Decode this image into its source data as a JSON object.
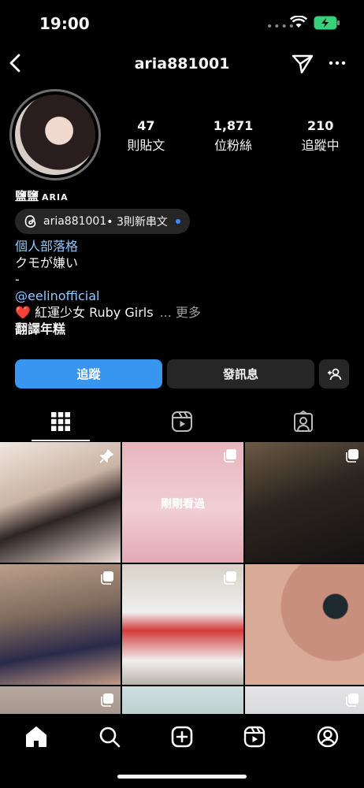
{
  "status": {
    "time": "19:00"
  },
  "header": {
    "username": "aria881001"
  },
  "profile": {
    "stats": [
      {
        "value": "47",
        "label": "則貼文"
      },
      {
        "value": "1,871",
        "label": "位粉絲"
      },
      {
        "value": "210",
        "label": "追蹤中"
      }
    ],
    "display_name": "鹽鹽",
    "display_name_latin": "ARIA",
    "threads": {
      "handle": "aria881001",
      "suffix": " • 3則新串文"
    },
    "bio": {
      "category": "個人部落格",
      "line1": "クモが嫌い",
      "line2": "-",
      "mention": "@eelinofficial",
      "line3": "❤️ 紅運少女 Ruby Girls",
      "more": "... 更多",
      "translate": "翻譯年糕"
    }
  },
  "buttons": {
    "follow": "追蹤",
    "message": "發訊息"
  },
  "grid": {
    "recent_label": "剛剛看過"
  },
  "colors": {
    "accent": "#3896f0",
    "link": "#8fc7ff",
    "threads_dot": "#3d8bff"
  }
}
